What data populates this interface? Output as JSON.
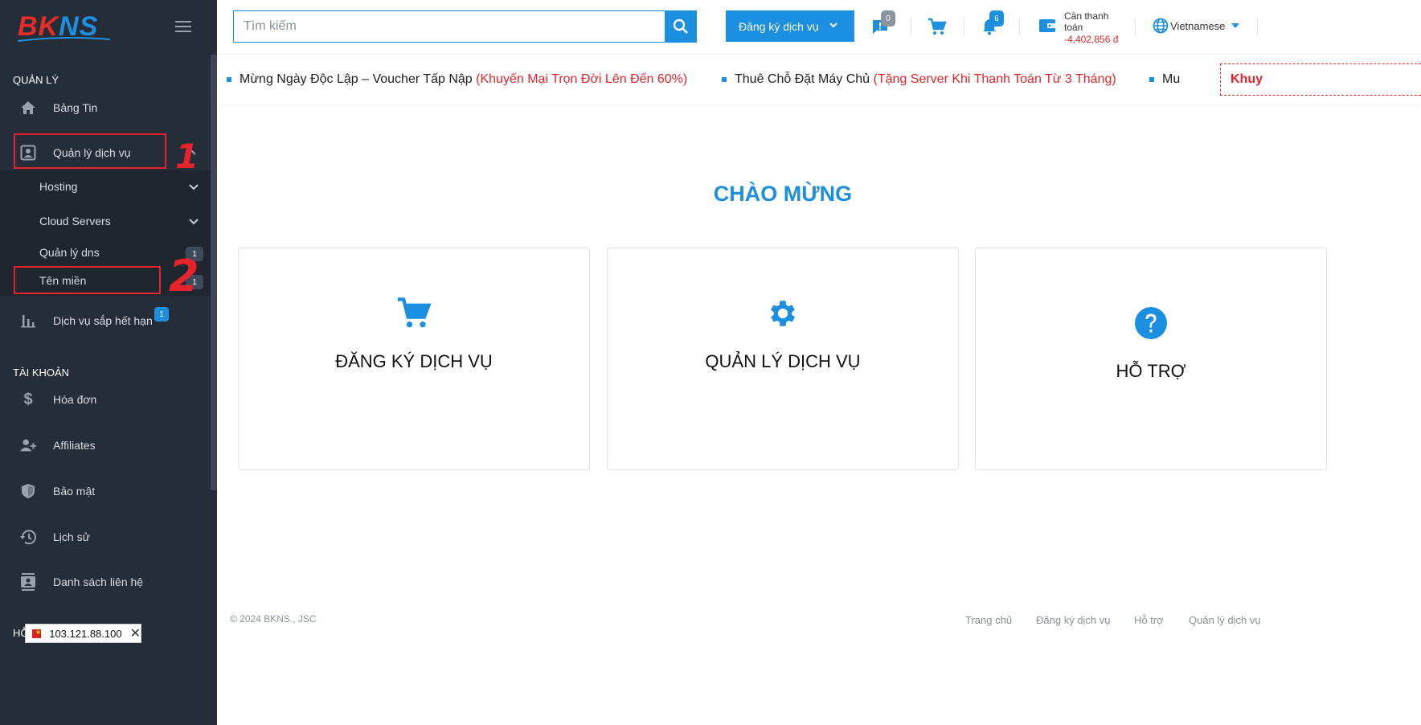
{
  "brand": {
    "logo_bk": "BK",
    "logo_ns": "NS"
  },
  "sidebar": {
    "section_manage": "QUẢN LÝ",
    "news": "Bảng Tin",
    "service_manage": "Quản lý dịch vụ",
    "sub": {
      "hosting": "Hosting",
      "cloud": "Cloud Servers",
      "dns": "Quản lý dns",
      "dns_badge": "1",
      "domain": "Tên miền",
      "domain_badge": "1"
    },
    "expiring": "Dịch vụ sắp hết hạn",
    "expiring_badge": "1",
    "section_account": "TÀI KHOẢN",
    "invoice": "Hóa đơn",
    "affiliates": "Affiliates",
    "security": "Bảo mật",
    "history": "Lịch sử",
    "contacts": "Danh sách liên hệ",
    "bottom_cut": "HỖ"
  },
  "annotations": {
    "one": "1",
    "two": "2"
  },
  "ip_widget": {
    "ip": "103.121.88.100"
  },
  "header": {
    "search_placeholder": "Tìm kiếm",
    "register_button": "Đăng ký dịch vụ",
    "tickets_badge": "0",
    "notifications_badge": "6",
    "balance_label": "Cần thanh toán",
    "balance_value": "-4,402,856 đ",
    "language": "Vietnamese"
  },
  "ticker": {
    "item1": "Mừng Ngày Độc Lập – Voucher Tấp Nập",
    "item1_red": "(Khuyến Mại Trọn Đời Lên Đến 60%)",
    "item2": "Thuê Chỗ Đặt Máy Chủ",
    "item2_red": "(Tặng Server Khi Thanh Toán Từ 3 Tháng)",
    "item3": "Mu",
    "promo": "Khuy"
  },
  "main": {
    "welcome": "CHÀO MỪNG",
    "cards": [
      {
        "title": "ĐĂNG KÝ DỊCH VỤ",
        "icon": "cart-icon"
      },
      {
        "title": "QUẢN LÝ DỊCH VỤ",
        "icon": "gear-icon"
      },
      {
        "title": "HỖ TRỢ",
        "icon": "help-icon"
      }
    ]
  },
  "footer": {
    "copyright": "© 2024 BKNS., JSC",
    "links": [
      "Trang chủ",
      "Đăng ký dịch vụ",
      "Hỗ trợ",
      "Quản lý dịch vụ"
    ]
  },
  "colors": {
    "accent": "#1d8fe1",
    "sidebar": "#252d38",
    "alert": "#e4242a"
  }
}
